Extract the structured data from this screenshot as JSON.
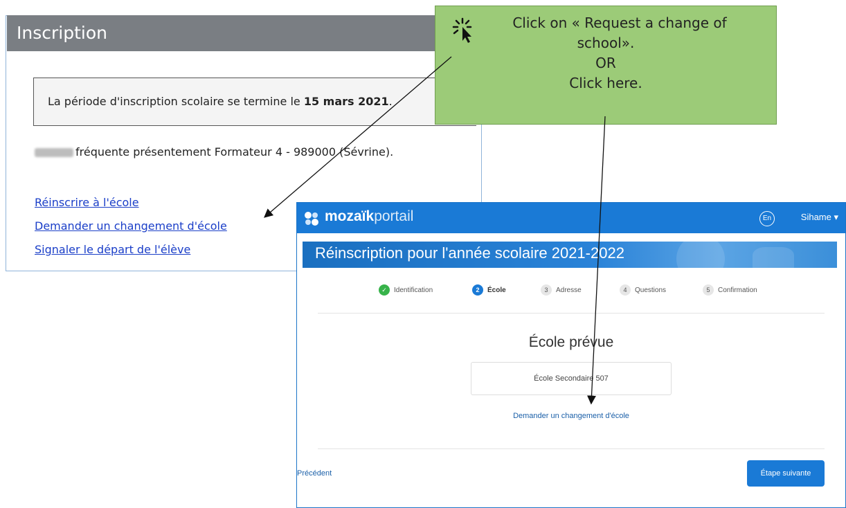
{
  "inscription": {
    "title": "Inscription",
    "period_prefix": "La période d'inscription scolaire se termine le ",
    "period_date": "15 mars 2021",
    "period_suffix": ".",
    "student_text": "fréquente présentement Formateur 4 - 989000 (Sévrine).",
    "links": [
      "Réinscrire à l'école",
      "Demander un changement d'école",
      "Signaler le départ de l'élève"
    ]
  },
  "callout": {
    "lines": [
      "Click on « Request a change of",
      "school».",
      "OR",
      "Click here."
    ],
    "icon": "click-cursor-icon",
    "color": "#9ccb78"
  },
  "portal": {
    "logo_bold": "mozaïk",
    "logo_light": "portail",
    "lang": "En",
    "user": "Sihame ▾",
    "banner_title": "Réinscription pour l'année scolaire 2021-2022",
    "steps": [
      {
        "num": "✓",
        "label": "Identification",
        "state": "done"
      },
      {
        "num": "2",
        "label": "École",
        "state": "active"
      },
      {
        "num": "3",
        "label": "Adresse",
        "state": "pending"
      },
      {
        "num": "4",
        "label": "Questions",
        "state": "pending"
      },
      {
        "num": "5",
        "label": "Confirmation",
        "state": "pending"
      }
    ],
    "section_title": "École prévue",
    "school_value": "École Secondaire 507",
    "change_link": "Demander un changement d'école",
    "prev_label": "Précédent",
    "next_label": "Étape suivante",
    "accent": "#1a7ad6"
  }
}
